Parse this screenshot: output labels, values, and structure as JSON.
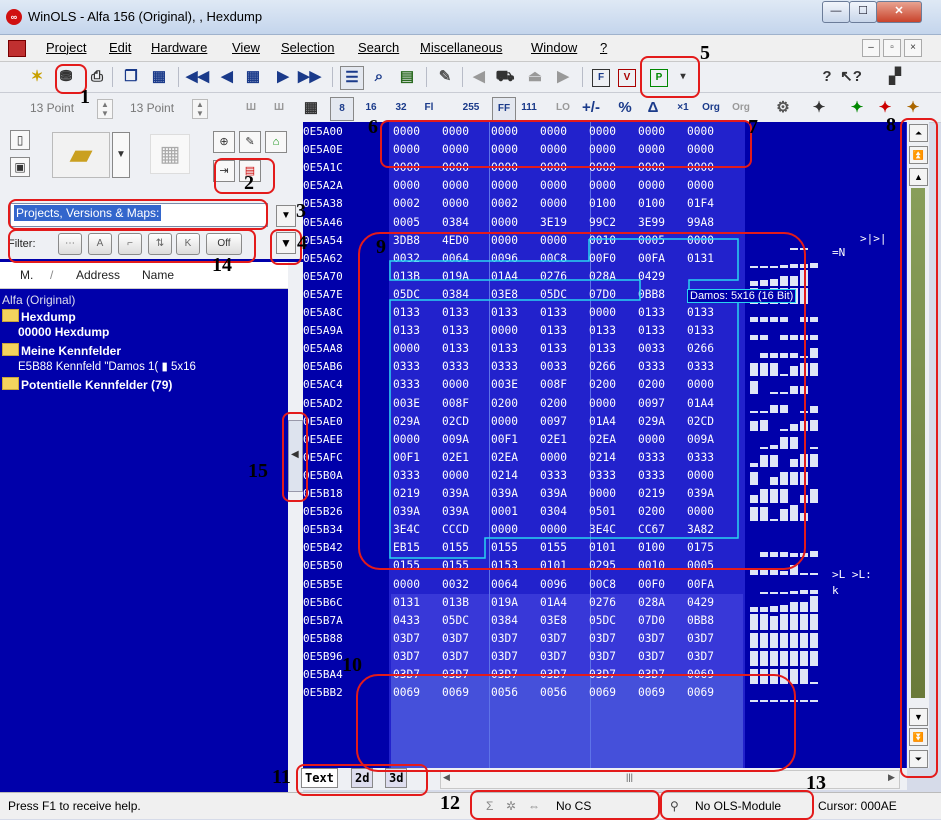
{
  "window": {
    "title": "WinOLS - Alfa 156 (Original), , Hexdump",
    "app_icon": "∞",
    "minimize": "—",
    "maximize": "☐",
    "close": "✕"
  },
  "menu": {
    "items": [
      "Project",
      "Edit",
      "Hardware",
      "View",
      "Selection",
      "Search",
      "Miscellaneous",
      "Window",
      "?"
    ],
    "mdi_buttons": [
      "–",
      "▫",
      "×"
    ]
  },
  "toolbar2": {
    "font_size_1": "13 Point",
    "font_size_2": "13 Point"
  },
  "combo": {
    "value": "Projects, Versions & Maps:"
  },
  "filter": {
    "label": "Filter:",
    "off_button": "Off"
  },
  "tree_header": {
    "col_m": "M.",
    "sort_mark": "/",
    "col_address": "Address",
    "col_name": "Name"
  },
  "tree": {
    "root": "Alfa (Original)",
    "hexdump_folder": "Hexdump",
    "hexdump_item": "00000  Hexdump",
    "kennfelder_folder": "Meine Kennfelder",
    "kennfeld_item": "E5B88   Kennfeld \"Damos 1( ▮ 5x16",
    "potentielle": "Potentielle Kennfelder (79)"
  },
  "hex": {
    "addresses": [
      "0E5A00",
      "0E5A0E",
      "0E5A1C",
      "0E5A2A",
      "0E5A38",
      "0E5A46",
      "0E5A54",
      "0E5A62",
      "0E5A70",
      "0E5A7E",
      "0E5A8C",
      "0E5A9A",
      "0E5AA8",
      "0E5AB6",
      "0E5AC4",
      "0E5AD2",
      "0E5AE0",
      "0E5AEE",
      "0E5AFC",
      "0E5B0A",
      "0E5B18",
      "0E5B26",
      "0E5B34",
      "0E5B42",
      "0E5B50",
      "0E5B5E",
      "0E5B6C",
      "0E5B7A",
      "0E5B88",
      "0E5B96",
      "0E5BA4",
      "0E5BB2"
    ],
    "rows": [
      [
        "0000",
        "0000",
        "0000",
        "0000",
        "0000",
        "0000",
        "0000"
      ],
      [
        "0000",
        "0000",
        "0000",
        "0000",
        "0000",
        "0000",
        "0000"
      ],
      [
        "0000",
        "0000",
        "0000",
        "0000",
        "0000",
        "0000",
        "0000"
      ],
      [
        "0000",
        "0000",
        "0000",
        "0000",
        "0000",
        "0000",
        "0000"
      ],
      [
        "0002",
        "0000",
        "0002",
        "0000",
        "0100",
        "0100",
        "01F4"
      ],
      [
        "0005",
        "0384",
        "0000",
        "3E19",
        "99C2",
        "3E99",
        "99A8"
      ],
      [
        "3DB8",
        "4ED0",
        "0000",
        "0000",
        "0010",
        "0005",
        "0000"
      ],
      [
        "0032",
        "0064",
        "0096",
        "00C8",
        "00F0",
        "00FA",
        "0131"
      ],
      [
        "013B",
        "019A",
        "01A4",
        "0276",
        "028A",
        "0429",
        ""
      ],
      [
        "05DC",
        "0384",
        "03E8",
        "05DC",
        "07D0",
        "0BB8",
        "0000"
      ],
      [
        "0133",
        "0133",
        "0133",
        "0133",
        "0000",
        "0133",
        "0133"
      ],
      [
        "0133",
        "0133",
        "0000",
        "0133",
        "0133",
        "0133",
        "0133"
      ],
      [
        "0000",
        "0133",
        "0133",
        "0133",
        "0133",
        "0033",
        "0266"
      ],
      [
        "0333",
        "0333",
        "0333",
        "0033",
        "0266",
        "0333",
        "0333"
      ],
      [
        "0333",
        "0000",
        "003E",
        "008F",
        "0200",
        "0200",
        "0000"
      ],
      [
        "003E",
        "008F",
        "0200",
        "0200",
        "0000",
        "0097",
        "01A4"
      ],
      [
        "029A",
        "02CD",
        "0000",
        "0097",
        "01A4",
        "029A",
        "02CD"
      ],
      [
        "0000",
        "009A",
        "00F1",
        "02E1",
        "02EA",
        "0000",
        "009A"
      ],
      [
        "00F1",
        "02E1",
        "02EA",
        "0000",
        "0214",
        "0333",
        "0333"
      ],
      [
        "0333",
        "0000",
        "0214",
        "0333",
        "0333",
        "0333",
        "0000"
      ],
      [
        "0219",
        "039A",
        "039A",
        "039A",
        "0000",
        "0219",
        "039A"
      ],
      [
        "039A",
        "039A",
        "0001",
        "0304",
        "0501",
        "0200",
        "0000"
      ],
      [
        "3E4C",
        "CCCD",
        "0000",
        "0000",
        "3E4C",
        "CC67",
        "3A82"
      ],
      [
        "EB15",
        "0155",
        "0155",
        "0155",
        "0101",
        "0100",
        "0175"
      ],
      [
        "0155",
        "0155",
        "0153",
        "0101",
        "0295",
        "0010",
        "0005"
      ],
      [
        "0000",
        "0032",
        "0064",
        "0096",
        "00C8",
        "00F0",
        "00FA"
      ],
      [
        "0131",
        "013B",
        "019A",
        "01A4",
        "0276",
        "028A",
        "0429"
      ],
      [
        "0433",
        "05DC",
        "0384",
        "03E8",
        "05DC",
        "07D0",
        "0BB8"
      ],
      [
        "03D7",
        "03D7",
        "03D7",
        "03D7",
        "03D7",
        "03D7",
        "03D7"
      ],
      [
        "03D7",
        "03D7",
        "03D7",
        "03D7",
        "03D7",
        "03D7",
        "03D7"
      ],
      [
        "03D7",
        "03D7",
        "03D7",
        "03D7",
        "03D7",
        "03D7",
        "0069"
      ],
      [
        "0069",
        "0069",
        "0056",
        "0056",
        "0069",
        "0069",
        "0069"
      ]
    ],
    "tooltip": "Damos: 5x16 (16 Bit)",
    "text_col": [
      ">|>|",
      "=N",
      ">L   >L:",
      "k"
    ]
  },
  "tabs": [
    "Text",
    "2d",
    "3d"
  ],
  "status": {
    "help": "Press F1 to receive help.",
    "checksum": "No CS",
    "ols_module": "No OLS-Module",
    "cursor": "Cursor: 000AE"
  },
  "annotations": [
    "1",
    "2",
    "3",
    "4",
    "5",
    "6",
    "7",
    "8",
    "9",
    "10",
    "11",
    "12",
    "13",
    "14",
    "15"
  ],
  "colors": {
    "hex_background": "#2222cc",
    "tree_background": "#0000aa",
    "map_outline": "#29d3f0",
    "annotation": "#e31b1b"
  }
}
